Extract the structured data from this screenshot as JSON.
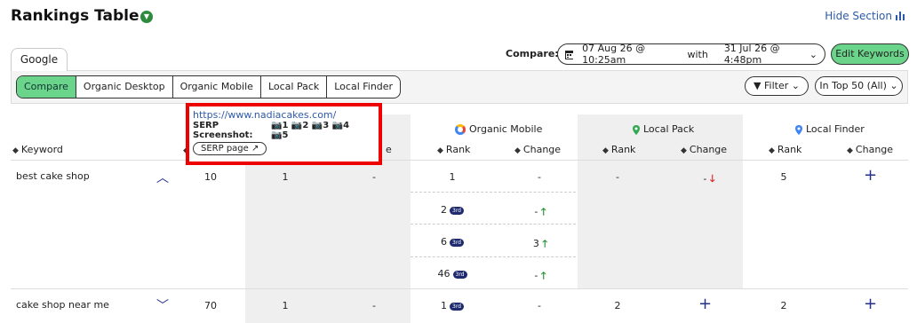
{
  "header": {
    "title": "Rankings Table",
    "hide_section": "Hide Section"
  },
  "tabs": {
    "google": "Google"
  },
  "views": [
    "Compare",
    "Organic Desktop",
    "Organic Mobile",
    "Local Pack",
    "Local Finder"
  ],
  "compare": {
    "label": "Compare:",
    "from": "07 Aug 26 @ 10:25am",
    "with": "with",
    "to": "31 Jul 26 @ 4:48pm"
  },
  "edit_keywords": "Edit Keywords",
  "filter": "Filter",
  "top50": "In Top 50 (All)",
  "columns": {
    "keyword": "Keyword",
    "organic_mobile": "Organic Mobile",
    "local_pack": "Local Pack",
    "local_finder": "Local Finder",
    "rank": "Rank",
    "change": "Change",
    "change_partial": "e"
  },
  "popup": {
    "url": "https://www.nadiacakes.com/",
    "serp_label": "SERP",
    "serp_shots": [
      "1",
      "2",
      "3",
      "4"
    ],
    "screenshot_label": "Screenshot:",
    "screenshot_shot": "5",
    "serp_page": "SERP page"
  },
  "rows": [
    {
      "keyword": "best cake shop",
      "col_a": "10",
      "desk_rank": "1",
      "desk_change": "-",
      "mobile": [
        {
          "rank": "1",
          "badge": "",
          "change": "-",
          "dir": ""
        },
        {
          "rank": "2",
          "badge": "3rd",
          "change": "-",
          "dir": "up"
        },
        {
          "rank": "6",
          "badge": "3rd",
          "change": "3",
          "dir": "up"
        },
        {
          "rank": "46",
          "badge": "3rd",
          "change": "-",
          "dir": "up"
        }
      ],
      "lp_rank": "-",
      "lp_change": "-",
      "lf_rank": "5"
    },
    {
      "keyword": "cake shop near me",
      "col_a": "70",
      "desk_rank": "1",
      "desk_change": "-",
      "mobile_rank": "1",
      "mobile_badge": "3rd",
      "mobile_change": "-",
      "lp_rank": "2",
      "lf_rank": "2"
    }
  ],
  "colors": {
    "accent_green": "#6bd48b",
    "link_blue": "#2d5aa8",
    "navy": "#1f2b6e",
    "up": "#1c8f2e",
    "down": "#d22222"
  }
}
